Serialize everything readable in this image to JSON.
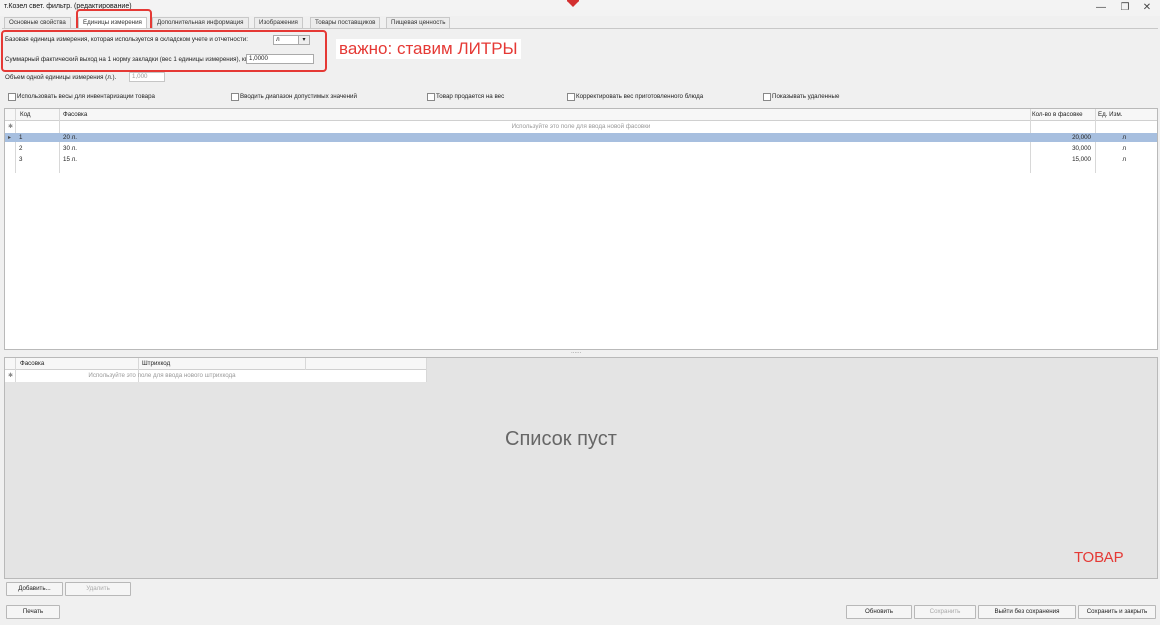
{
  "window": {
    "title": "т.Козел свет. фильтр. (редактирование)",
    "minimize": "—",
    "maximize": "❐",
    "close": "✕"
  },
  "tabs": [
    {
      "label": "Основные свойства"
    },
    {
      "label": "Единицы измерения"
    },
    {
      "label": "Дополнительная информация"
    },
    {
      "label": "Изображения"
    },
    {
      "label": "Товары поставщиков"
    },
    {
      "label": "Пищевая ценность"
    }
  ],
  "form": {
    "base_unit_label": "Базовая единица измерения, которая используется в складском учете и отчетности:",
    "base_unit_value": "л",
    "total_output_label": "Суммарный фактический выход на 1 норму закладки (вес 1 единицы измерения), кг.:",
    "total_output_value": "1,0000",
    "volume_label": "Объем одной единицы измерения (л.).",
    "volume_value": "1,000"
  },
  "annotation": {
    "text": "важно: ставим ЛИТРЫ",
    "color": "#e53935"
  },
  "checkboxes": [
    {
      "label": "Использовать весы для инвентаризации товара"
    },
    {
      "label": "Вводить диапазон допустимых значений"
    },
    {
      "label": "Товар продается на вес"
    },
    {
      "label": "Корректировать вес приготовленного блюда"
    },
    {
      "label": "Показывать удаленные"
    }
  ],
  "packaging_grid": {
    "headers": {
      "code": "Код",
      "packaging": "Фасовка",
      "qty": "Кол-во в фасовке",
      "unit": "Ед. Изм."
    },
    "new_row_marker": "✱",
    "new_row_hint": "Используйте это поле для ввода новой фасовки",
    "rows": [
      {
        "code": "1",
        "packaging": "20 л.",
        "qty": "20,000",
        "unit": "л",
        "selected": true
      },
      {
        "code": "2",
        "packaging": "30 л.",
        "qty": "30,000",
        "unit": "л",
        "selected": false
      },
      {
        "code": "3",
        "packaging": "15 л.",
        "qty": "15,000",
        "unit": "л",
        "selected": false
      }
    ],
    "selected_color": "#a7bfdf"
  },
  "splitter": "......",
  "barcode_grid": {
    "headers": {
      "packaging": "Фасовка",
      "barcode": "Штрихкод"
    },
    "new_row_marker": "✱",
    "new_row_hint": "Используйте это поле для ввода нового штрихкода",
    "empty_text": "Список пуст"
  },
  "tovar_label": "ТОВАР",
  "barcode_buttons": {
    "add": "Добавить...",
    "delete": "Удалить"
  },
  "footer": {
    "print": "Печать",
    "refresh": "Обновить",
    "save": "Сохранить",
    "exit_no_save": "Выйти без сохранения",
    "save_close": "Сохранить и закрыть"
  }
}
